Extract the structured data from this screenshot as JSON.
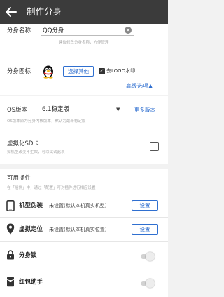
{
  "header": {
    "title": "制作分身"
  },
  "clone_name": {
    "label": "分身名称",
    "value": "QQ分身",
    "hint": "建议修改分身名称，方便管理"
  },
  "clone_icon": {
    "label": "分身图标",
    "choose_label": "选择其他",
    "remove_logo_label": "去LOGO水印",
    "remove_logo_checked": true
  },
  "advanced_options": "高级选项▲",
  "os_version": {
    "label": "OS版本",
    "value": "6.1稳定版",
    "more_label": "更多版本",
    "hint": "OS版本原为分身内核版本，默认为最新稳定版"
  },
  "virtual_sd": {
    "label": "虚拟化SD卡",
    "hint": "如机型改变不生效，可以试试此项",
    "checked": false
  },
  "plugins": {
    "title": "可用插件",
    "hint": "在「插件」中，通过「配置」可对插件进行相应设置",
    "items": [
      {
        "icon": "phone-icon",
        "title": "机型伪装",
        "value": "未设置(默认本机真实机型)",
        "button": "设置"
      },
      {
        "icon": "location-pin-icon",
        "title": "虚拟定位",
        "value": "未设置(默认本机真实位置)",
        "button": "设置"
      },
      {
        "icon": "lock-icon",
        "title": "分身锁",
        "toggle": false
      },
      {
        "icon": "red-packet-icon",
        "title": "红包助手",
        "toggle": false
      }
    ]
  },
  "colors": {
    "accent": "#2f6fd0",
    "topbar": "#3b3b3b"
  }
}
